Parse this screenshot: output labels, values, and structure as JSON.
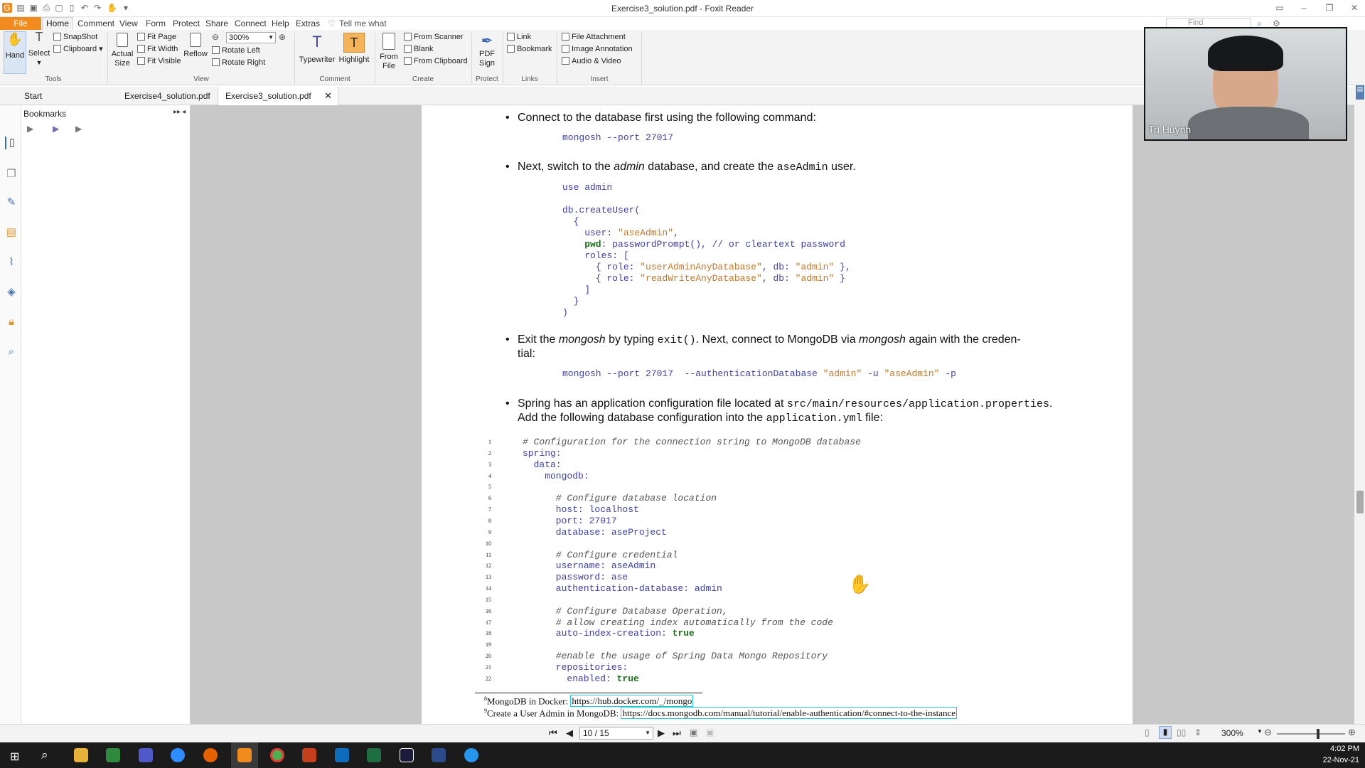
{
  "window": {
    "title": "Exercise3_solution.pdf - Foxit Reader",
    "find_placeholder": "Find"
  },
  "menu": {
    "file": "File",
    "items": [
      "Home",
      "Comment",
      "View",
      "Form",
      "Protect",
      "Share",
      "Connect",
      "Help",
      "Extras"
    ],
    "tell_me": "Tell me what"
  },
  "ribbon": {
    "hand": "Hand",
    "select": "Select",
    "snapshot": "SnapShot",
    "clipboard": "Clipboard",
    "actual_size": "Actual",
    "actual_size2": "Size",
    "fit_page": "Fit Page",
    "fit_width": "Fit Width",
    "fit_visible": "Fit Visible",
    "reflow": "Reflow",
    "zoom_value": "300%",
    "rotate_left": "Rotate Left",
    "rotate_right": "Rotate Right",
    "typewriter": "Typewriter",
    "highlight": "Highlight",
    "from_file": "From",
    "from_file2": "File",
    "from_scanner": "From Scanner",
    "blank": "Blank",
    "from_clipboard": "From Clipboard",
    "pdf_sign": "PDF",
    "pdf_sign2": "Sign",
    "link": "Link",
    "bookmark": "Bookmark",
    "file_attachment": "File Attachment",
    "image_annotation": "Image Annotation",
    "audio_video": "Audio & Video",
    "groups": {
      "tools": "Tools",
      "view": "View",
      "comment": "Comment",
      "create": "Create",
      "protect": "Protect",
      "links": "Links",
      "insert": "Insert"
    }
  },
  "tabs": {
    "start": "Start",
    "tab1": "Exercise4_solution.pdf",
    "tab2": "Exercise3_solution.pdf"
  },
  "bookmarks": {
    "title": "Bookmarks"
  },
  "doc": {
    "b1_text": "Connect to the database first using the following command:",
    "b1_code": "mongosh --port 27017",
    "b2_a": "Next, switch to the ",
    "b2_b": "admin",
    "b2_c": " database, and create the ",
    "b2_d": "aseAdmin",
    "b2_e": " user.",
    "code2": {
      "l1": "use admin",
      "l2": "db.createUser(",
      "l3": "  {",
      "l4a": "    user: ",
      "l4b": "\"aseAdmin\"",
      "l4c": ",",
      "l5a": "    pwd",
      "l5b": ": passwordPrompt(), // or cleartext password",
      "l6": "    roles: [",
      "l7a": "      { role: ",
      "l7b": "\"userAdminAnyDatabase\"",
      "l7c": ", db: ",
      "l7d": "\"admin\"",
      "l7e": " },",
      "l8a": "      { role: ",
      "l8b": "\"readWriteAnyDatabase\"",
      "l8c": ", db: ",
      "l8d": "\"admin\"",
      "l8e": " }",
      "l9": "    ]",
      "l10": "  }",
      "l11": ")"
    },
    "b3_a": "Exit the ",
    "b3_b": "mongosh",
    "b3_c": " by typing ",
    "b3_d": "exit()",
    "b3_e": ". Next, connect to MongoDB via ",
    "b3_f": "mongosh",
    "b3_g": " again with the creden-",
    "b3_h": "tial:",
    "b3_code_a": "mongosh --port 27017  --authenticationDatabase ",
    "b3_code_b": "\"admin\"",
    "b3_code_c": " -u ",
    "b3_code_d": "\"aseAdmin\"",
    "b3_code_e": " -p",
    "b4_a": "Spring has an application configuration file located at ",
    "b4_b": "src/main/resources/application.properties",
    "b4_c": ".",
    "b4_d": "Add the following database configuration into the ",
    "b4_e": "application.yml",
    "b4_f": " file:",
    "yml": [
      {
        "n": "1",
        "t": "# Configuration for the connection string to MongoDB database",
        "c": "cm",
        "i": 0
      },
      {
        "n": "2",
        "t": "spring:",
        "c": "",
        "i": 0
      },
      {
        "n": "3",
        "t": "  data:",
        "c": "",
        "i": 0
      },
      {
        "n": "4",
        "t": "    mongodb:",
        "c": "",
        "i": 0
      },
      {
        "n": "5",
        "t": "",
        "c": "",
        "i": 0
      },
      {
        "n": "6",
        "t": "      # Configure database location",
        "c": "cm",
        "i": 0
      },
      {
        "n": "7",
        "t": "      host: localhost",
        "c": "",
        "i": 0
      },
      {
        "n": "8",
        "t": "      port: 27017",
        "c": "",
        "i": 0
      },
      {
        "n": "9",
        "t": "      database: aseProject",
        "c": "",
        "i": 0
      },
      {
        "n": "10",
        "t": "",
        "c": "",
        "i": 0
      },
      {
        "n": "11",
        "t": "      # Configure credential",
        "c": "cm",
        "i": 0
      },
      {
        "n": "12",
        "t": "      username: aseAdmin",
        "c": "",
        "i": 0
      },
      {
        "n": "13",
        "t": "      password: ase",
        "c": "",
        "i": 0
      },
      {
        "n": "14",
        "t": "      authentication-database: admin",
        "c": "",
        "i": 0
      },
      {
        "n": "15",
        "t": "",
        "c": "",
        "i": 0
      },
      {
        "n": "16",
        "t": "      # Configure Database Operation,",
        "c": "cm",
        "i": 0
      },
      {
        "n": "17",
        "t": "      # allow creating index automatically from the code",
        "c": "cm",
        "i": 0
      },
      {
        "n": "18",
        "t": "      auto-index-creation: ",
        "c": "",
        "k": "true",
        "i": 0
      },
      {
        "n": "19",
        "t": "",
        "c": "",
        "i": 0
      },
      {
        "n": "20",
        "t": "      #enable the usage of Spring Data Mongo Repository",
        "c": "cm",
        "i": 0
      },
      {
        "n": "21",
        "t": "      repositories:",
        "c": "",
        "i": 0
      },
      {
        "n": "22",
        "t": "        enabled: ",
        "c": "",
        "k": "true",
        "i": 0
      }
    ],
    "fn8_num": "8",
    "fn8_text": "MongoDB in Docker: ",
    "fn8_link": "https://hub.docker.com/_/mongo",
    "fn9_num": "9",
    "fn9_text": "Create a User Admin in MongoDB: ",
    "fn9_link": "https://docs.mongodb.com/manual/tutorial/enable-authentication/#connect-to-the-instance"
  },
  "webcam": {
    "name": "Tri Huynh"
  },
  "status": {
    "page": "10 / 15",
    "zoom": "300%"
  },
  "taskbar": {
    "time": "4:02 PM",
    "date": "22-Nov-21"
  },
  "colors": {
    "accent": "#f28b1e",
    "code_blue": "#4040a0",
    "code_string": "#c0782a",
    "code_keyword": "#177017",
    "link_border": "#26c6d0"
  }
}
